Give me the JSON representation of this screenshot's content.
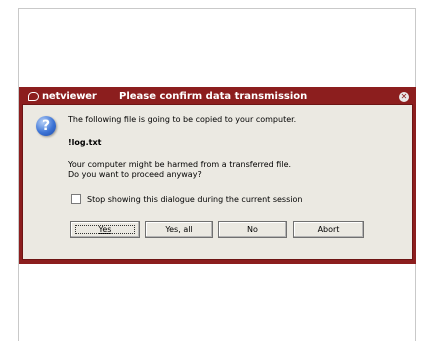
{
  "dialog": {
    "logo_text": "netviewer",
    "title": "Please confirm data transmission",
    "close_symbol": "✕",
    "question_mark": "?",
    "message_intro": "The following file is going to be copied to your computer.",
    "filename": "!log.txt",
    "warning_line1": "Your computer might be harmed from a transferred file.",
    "warning_line2": "Do you want to proceed anyway?",
    "checkbox_label": "Stop showing this dialogue during the current session",
    "checkbox_checked": false,
    "buttons": {
      "yes": "Yes",
      "yes_all": "Yes, all",
      "no": "No",
      "abort": "Abort"
    },
    "colors": {
      "titlebar": "#8c1e1e",
      "body": "#ebe9e2"
    },
    "icons": [
      "netviewer-logo-icon",
      "close-icon",
      "question-icon"
    ]
  }
}
